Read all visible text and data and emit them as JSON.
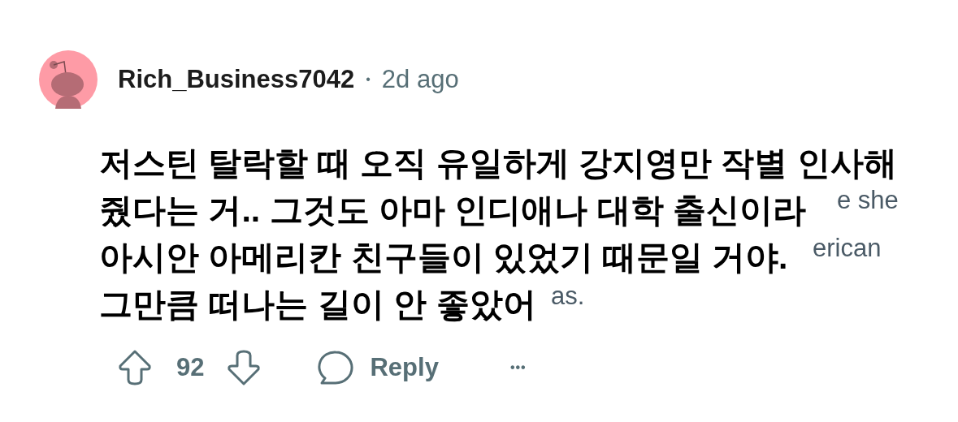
{
  "comment": {
    "author": "Rich_Business7042",
    "separator": "•",
    "time": "2d ago",
    "lines": [
      "저스틴 탈락할 때 오직 유일하게 강지영만 작별 인사해",
      "줬다는 거.. 그것도 아마 인디애나 대학 출신이라",
      "아시안 아메리칸 친구들이 있었기 때문일 거야.",
      "그만큼 떠나는 길이 안 좋았어"
    ],
    "underlying_fragments": [
      "e she",
      "erican",
      "as."
    ],
    "votes": "92",
    "reply_label": "Reply",
    "more_label": "•••"
  }
}
